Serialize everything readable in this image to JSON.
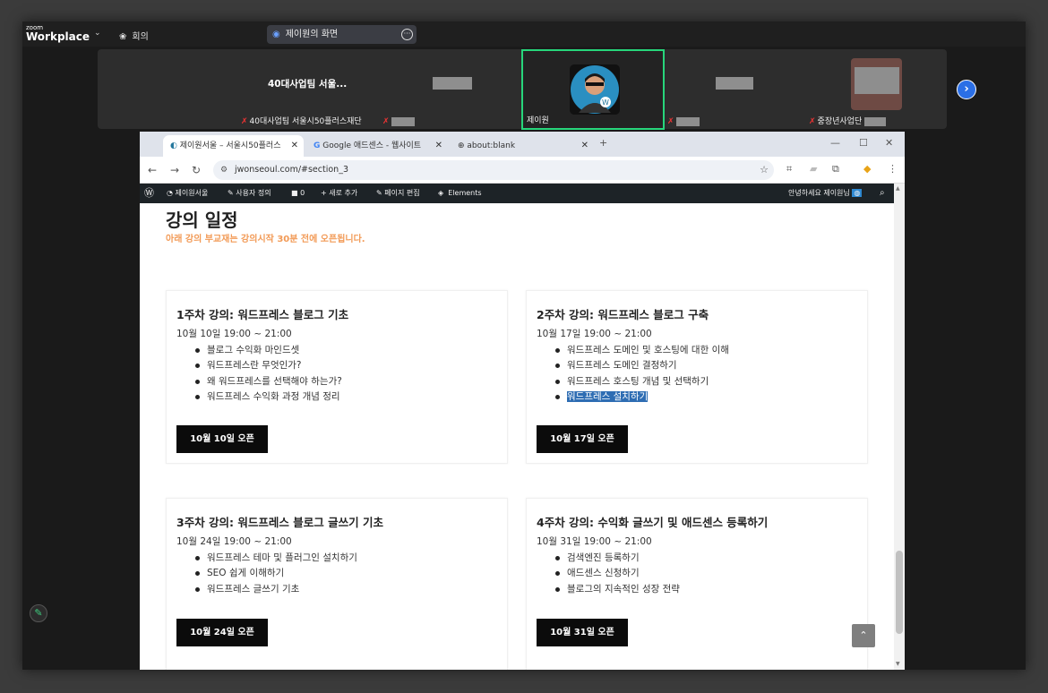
{
  "zoom": {
    "logo_small": "zoom",
    "logo_big": "Workplace",
    "meeting_label": "회의",
    "share_label": "제이원의 화면"
  },
  "participants": [
    {
      "tile_name": "40대사업팀 서울...",
      "label": "40대사업팀 서울시50플러스재단"
    },
    {
      "tile_name": "",
      "label": ""
    },
    {
      "tile_name": "",
      "label": "제이원"
    },
    {
      "tile_name": "",
      "label": ""
    },
    {
      "tile_name": "",
      "label": "중장년사업단"
    }
  ],
  "browser": {
    "tabs": [
      {
        "title": "제이원서울 – 서울시50플러스"
      },
      {
        "title": "Google 애드센스 - 웹사이트"
      },
      {
        "title": "about:blank"
      }
    ],
    "url": "jwonseoul.com/#section_3"
  },
  "wpbar": {
    "site": "제이원서울",
    "customize": "사용자 정의",
    "comments": "0",
    "new": "새로 추가",
    "edit": "페이지 편집",
    "elements": "Elements",
    "greeting": "안녕하세요 제이원님"
  },
  "page": {
    "title": "강의 일정",
    "subtitle": "아래 강의 부교재는 강의시작 30분 전에 오픈됩니다.",
    "cards": [
      {
        "title": "1주차 강의: 워드프레스 블로그 기초",
        "date": "10월 10일 19:00 ~ 21:00",
        "items": [
          "블로그 수익화 마인드셋",
          "워드프레스란 무엇인가?",
          "왜 워드프레스를 선택해야 하는가?",
          "워드프레스 수익화 과정 개념 정리"
        ],
        "button": "10월 10일 오픈"
      },
      {
        "title": "2주차 강의: 워드프레스 블로그 구축",
        "date": "10월 17일 19:00 ~ 21:00",
        "items": [
          "워드프레스 도메인 및 호스팅에 대한 이해",
          "워드프레스 도메인 결정하기",
          "워드프레스 호스팅 개념 및 선택하기",
          "워드프레스 설치하기"
        ],
        "button": "10월 17일 오픈"
      },
      {
        "title": "3주차 강의: 워드프레스 블로그 글쓰기 기초",
        "date": "10월 24일 19:00 ~ 21:00",
        "items": [
          "워드프레스 테마 및 플러그인 설치하기",
          "SEO 쉽게 이해하기",
          "워드프레스 글쓰기 기초"
        ],
        "button": "10월 24일 오픈"
      },
      {
        "title": "4주차 강의: 수익화 글쓰기 및 애드센스 등록하기",
        "date": "10월 31일 19:00 ~ 21:00",
        "items": [
          "검색엔진 등록하기",
          "애드센스 신청하기",
          "블로그의 지속적인 성장 전략"
        ],
        "button": "10월 31일 오픈"
      }
    ]
  }
}
